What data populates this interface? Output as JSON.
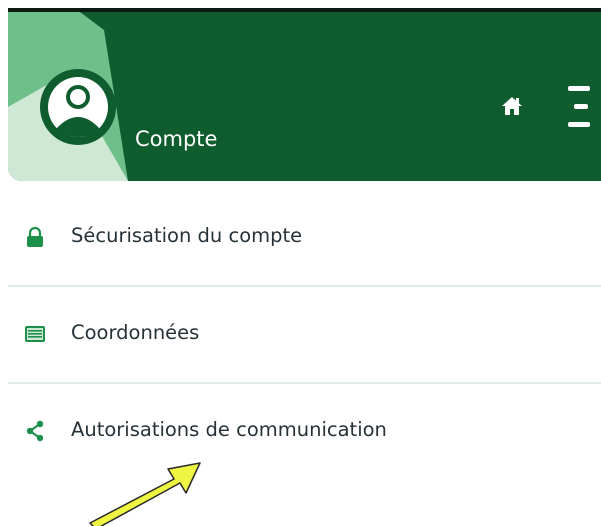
{
  "header": {
    "title": "Compte",
    "colors": {
      "dark_green": "#0f5c2f",
      "light_green": "#6fbf8b",
      "pale_green": "#cfe8d6"
    },
    "icons": [
      "avatar-icon",
      "home-icon",
      "menu-icon"
    ]
  },
  "menu": {
    "items": [
      {
        "label": "Sécurisation du compte",
        "icon": "lock-icon"
      },
      {
        "label": "Coordonnées",
        "icon": "id-card-icon"
      },
      {
        "label": "Autorisations de communication",
        "icon": "share-icon"
      }
    ]
  },
  "annotation": {
    "icon": "arrow-pointer",
    "color": "#eef542"
  }
}
